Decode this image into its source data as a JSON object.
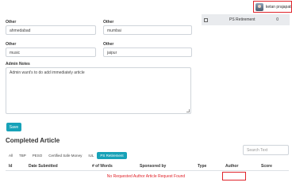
{
  "header": {
    "username": "ketan prajapati"
  },
  "form": {
    "row1": [
      {
        "label": "Other",
        "value": "ahmedabad"
      },
      {
        "label": "Other",
        "value": "mumbai"
      }
    ],
    "row2": [
      {
        "label": "Other",
        "value": "music"
      },
      {
        "label": "Other",
        "value": "jaipur"
      }
    ],
    "notes": {
      "label": "Admin Notes",
      "value": "Admin want's to do add immediately article"
    },
    "save_label": "Save"
  },
  "right_table": {
    "row_label": "PS Retirement",
    "row_count": "0"
  },
  "completed": {
    "title": "Completed Article",
    "search_placeholder": "Search Text",
    "tabs": [
      "All",
      "TBP",
      "PESO",
      "Certified Safe Money",
      "IUL",
      "PS Retirement"
    ],
    "active_tab": "PS Retirement",
    "columns": [
      "Id",
      "Date Submitted",
      "# of Words",
      "Sponsored by",
      "Type",
      "Author",
      "Score"
    ],
    "empty_message": "No Requested Author Article Request Found"
  },
  "colors": {
    "accent": "#17a2b8",
    "highlight": "#e0242b"
  },
  "icons": {
    "avatar": "user-avatar",
    "checkbox": "checkbox-icon",
    "resize": "resize-handle-icon"
  }
}
